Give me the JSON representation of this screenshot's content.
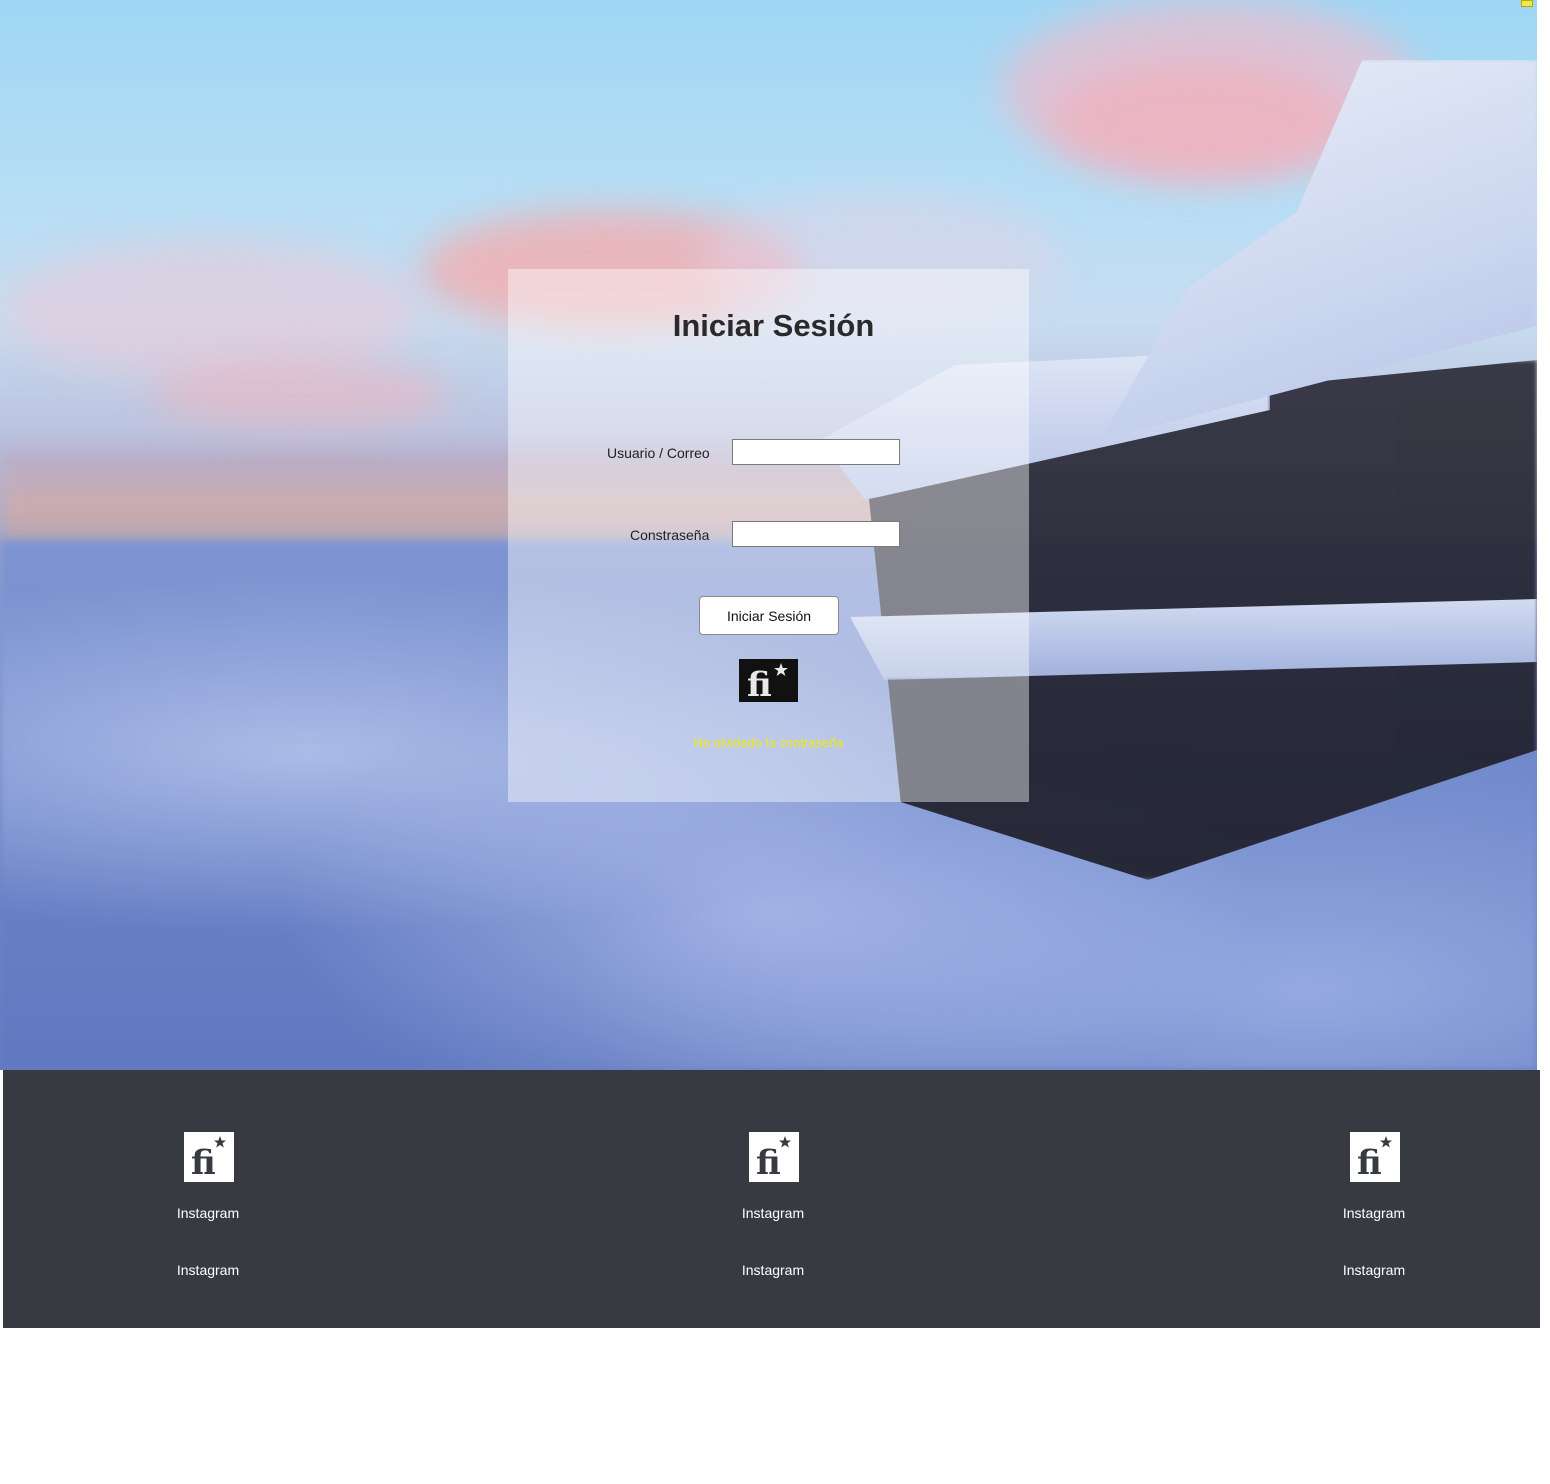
{
  "login": {
    "title": "Iniciar Sesión",
    "username_label": "Usuario / Correo",
    "username_value": "",
    "password_label": "Constraseña",
    "password_value": "",
    "submit_label": "Iniciar Sesión",
    "forgot_password_label": "He olvidado la contraseña",
    "logo_icon": "fi-star-logo-icon"
  },
  "footer": {
    "columns": [
      {
        "icon": "fi-star-logo-icon",
        "link1": "Instagram",
        "link2": "Instagram"
      },
      {
        "icon": "fi-star-logo-icon",
        "link1": "Instagram",
        "link2": "Instagram"
      },
      {
        "icon": "fi-star-logo-icon",
        "link1": "Instagram",
        "link2": "Instagram"
      }
    ]
  },
  "colors": {
    "footer_bg": "#373a41",
    "link_accent": "#f0ea10",
    "title_text": "#2a2a2a"
  }
}
